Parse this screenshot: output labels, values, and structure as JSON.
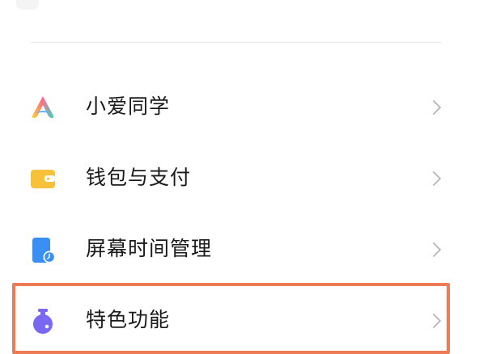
{
  "settings": {
    "items": [
      {
        "label": "小爱同学",
        "icon": "xiaoai-icon"
      },
      {
        "label": "钱包与支付",
        "icon": "wallet-icon"
      },
      {
        "label": "屏幕时间管理",
        "icon": "screen-time-icon"
      },
      {
        "label": "特色功能",
        "icon": "special-features-icon"
      }
    ],
    "highlighted_index": 3
  },
  "colors": {
    "highlight_border": "#ee7a56",
    "wallet_yellow": "#f7c23a",
    "screen_time_blue": "#3a8ff5",
    "special_purple": "#7a68f2",
    "chevron_gray": "#b5b5b5",
    "divider": "#e8e8e8"
  }
}
